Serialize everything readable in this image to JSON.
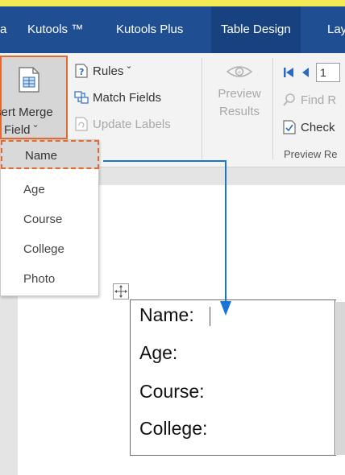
{
  "ribbon": {
    "tabs": [
      {
        "label": "Kutools ™"
      },
      {
        "label": "Kutools Plus"
      },
      {
        "label": "Table Design"
      },
      {
        "label": "Lay"
      }
    ],
    "insert_merge_field": {
      "label_line1": "sert Merge",
      "label_line2": "Field ˇ"
    },
    "rules_label": "Rules ˇ",
    "match_fields_label": "Match Fields",
    "update_labels_label": "Update Labels",
    "preview_results": {
      "line1": "Preview",
      "line2": "Results"
    },
    "record_number": "1",
    "find_recipient_label": "Find R",
    "check_label": "Check",
    "group_label": "Preview Re"
  },
  "merge_field_dropdown": {
    "items": [
      "Name",
      "Age",
      "Course",
      "College",
      "Photo"
    ]
  },
  "document": {
    "fields": [
      "Name:",
      "Age:",
      "Course:",
      "College:"
    ]
  },
  "colors": {
    "ribbon_tab_bar": "#1f4e93",
    "highlight_outline": "#e06a2f",
    "arrow": "#1a73d9",
    "top_stripe": "#f3ea55"
  }
}
